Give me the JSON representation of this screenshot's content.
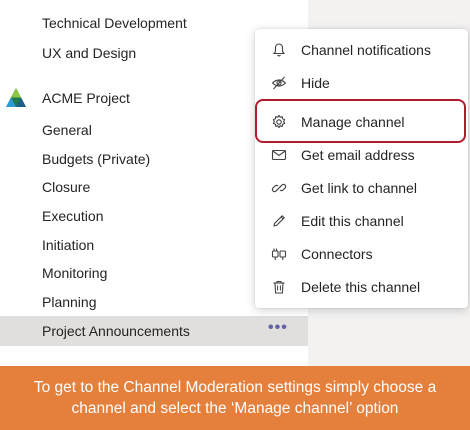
{
  "channels_above": [
    "Technical Development",
    "UX and Design"
  ],
  "team": {
    "name": "ACME Project",
    "logo_icon": "acme-triangle-logo"
  },
  "channels": [
    "General",
    "Budgets (Private)",
    "Closure",
    "Execution",
    "Initiation",
    "Monitoring",
    "Planning"
  ],
  "selected_channel": {
    "label": "Project Announcements",
    "more_glyph": "•••"
  },
  "menu": {
    "items": [
      {
        "label": "Channel notifications",
        "icon": "bell-icon"
      },
      {
        "label": "Hide",
        "icon": "hide-icon"
      },
      {
        "label": "Manage channel",
        "icon": "gear-icon",
        "highlighted": true
      },
      {
        "label": "Get email address",
        "icon": "envelope-icon"
      },
      {
        "label": "Get link to channel",
        "icon": "link-icon"
      },
      {
        "label": "Edit this channel",
        "icon": "pencil-icon"
      },
      {
        "label": "Connectors",
        "icon": "connectors-icon"
      },
      {
        "label": "Delete this channel",
        "icon": "trash-icon"
      }
    ]
  },
  "caption": {
    "line1": "To get to the Channel Moderation settings simply choose a",
    "line2": "channel and select the ‘Manage channel’ option"
  },
  "colors": {
    "highlight_border": "#b01c2e",
    "banner_bg": "#e47f3c",
    "accent": "#6264a7",
    "selected_bg": "#e1dfdd"
  }
}
